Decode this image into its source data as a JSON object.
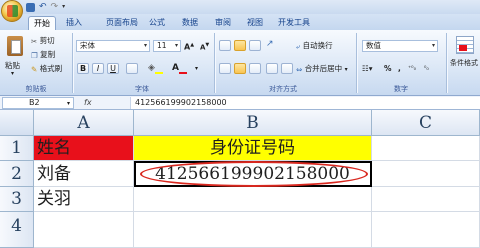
{
  "ribbon_tabs": [
    "开始",
    "插入",
    "页面布局",
    "公式",
    "数据",
    "审阅",
    "视图",
    "开发工具"
  ],
  "clipboard": {
    "paste": "粘贴",
    "cut": "剪切",
    "copy": "复制",
    "format_painter": "格式刷",
    "group_label": "剪贴板"
  },
  "font": {
    "name": "宋体",
    "size": "11",
    "group_label": "字体",
    "bold": "B",
    "italic": "I",
    "underline": "U"
  },
  "alignment": {
    "wrap_text": "自动换行",
    "merge_center": "合并后居中",
    "group_label": "对齐方式"
  },
  "number": {
    "format": "数值",
    "currency": "%",
    "comma": ",",
    "group_label": "数字"
  },
  "styles": {
    "conditional_formatting": "条件格式"
  },
  "formula_bar": {
    "name_box": "B2",
    "fx": "fx",
    "content": "412566199902158000"
  },
  "sheet": {
    "columns": [
      "A",
      "B",
      "C"
    ],
    "rows": [
      "1",
      "2",
      "3",
      "4"
    ],
    "cells": {
      "A1": "姓名",
      "B1": "身份证号码",
      "A2": "刘备",
      "B2": "412566199902158000",
      "A3": "关羽"
    }
  },
  "colors": {
    "header_fill_red": "#e8101b",
    "header_fill_yellow": "#ffff00",
    "annotation_ellipse": "#d9281f"
  }
}
